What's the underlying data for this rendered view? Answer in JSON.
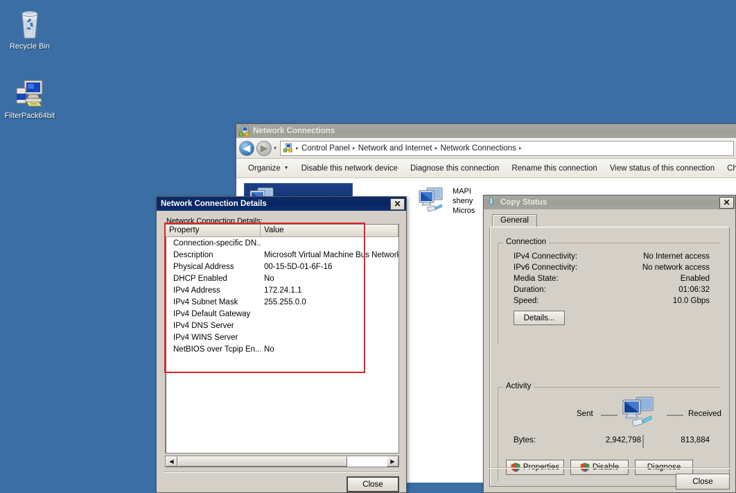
{
  "desktop": {
    "background_color": "#3a6ea5",
    "icons": [
      {
        "label": "Recycle Bin",
        "icon": "recycle-bin-icon"
      },
      {
        "label": "FilterPack64bit",
        "icon": "setup-installer-icon"
      }
    ]
  },
  "network_connections_window": {
    "title": "Network Connections",
    "icon": "network-connections-icon",
    "nav": {
      "back": "◀",
      "forward": "▶",
      "history_caret": "▾",
      "address_icon": "network-folder-icon",
      "breadcrumbs": [
        "Control Panel",
        "Network and Internet",
        "Network Connections"
      ],
      "separator": "▸"
    },
    "toolbar": [
      {
        "label": "Organize",
        "has_caret": true
      },
      {
        "label": "Disable this network device",
        "has_caret": false
      },
      {
        "label": "Diagnose this connection",
        "has_caret": false
      },
      {
        "label": "Rename this connection",
        "has_caret": false
      },
      {
        "label": "View status of this connection",
        "has_caret": false
      },
      {
        "label": "Change setti",
        "has_caret": false
      }
    ],
    "connections": [
      {
        "lines": [
          "MAPI",
          "sheny",
          "Micros"
        ],
        "icon": "network-adapter-icon",
        "selected": false
      }
    ]
  },
  "network_connection_details_dialog": {
    "title": "Network Connection Details",
    "close_glyph": "✕",
    "group_label": "Network Connection Details:",
    "columns": [
      "Property",
      "Value"
    ],
    "rows": [
      {
        "property": "Connection-specific DN...",
        "value": ""
      },
      {
        "property": "Description",
        "value": "Microsoft Virtual Machine Bus Network Ad"
      },
      {
        "property": "Physical Address",
        "value": "00-15-5D-01-6F-16"
      },
      {
        "property": "DHCP Enabled",
        "value": "No"
      },
      {
        "property": "IPv4 Address",
        "value": "172.24.1.1"
      },
      {
        "property": "IPv4 Subnet Mask",
        "value": "255.255.0.0"
      },
      {
        "property": "IPv4 Default Gateway",
        "value": ""
      },
      {
        "property": "IPv4 DNS Server",
        "value": ""
      },
      {
        "property": "IPv4 WINS Server",
        "value": ""
      },
      {
        "property": "NetBIOS over Tcpip En...",
        "value": "No"
      }
    ],
    "scroll_left_glyph": "◀",
    "scroll_right_glyph": "▶",
    "close_button": "Close"
  },
  "copy_status_dialog": {
    "title": "Copy Status",
    "icon": "status-icon",
    "close_glyph": "✕",
    "tab": "General",
    "connection": {
      "legend": "Connection",
      "rows": [
        {
          "label": "IPv4 Connectivity:",
          "value": "No Internet access"
        },
        {
          "label": "IPv6 Connectivity:",
          "value": "No network access"
        },
        {
          "label": "Media State:",
          "value": "Enabled"
        },
        {
          "label": "Duration:",
          "value": "01:06:32"
        },
        {
          "label": "Speed:",
          "value": "10.0 Gbps"
        }
      ],
      "details_button": "Details..."
    },
    "activity": {
      "legend": "Activity",
      "sent_label": "Sent",
      "received_label": "Received",
      "bytes_label": "Bytes:",
      "sent_bytes": "2,942,798",
      "received_bytes": "813,884",
      "icon": "computers-network-icon"
    },
    "buttons": [
      {
        "label": "Properties",
        "shield": true
      },
      {
        "label": "Disable",
        "shield": true
      },
      {
        "label": "Diagnose",
        "shield": false
      }
    ],
    "close_button": "Close"
  },
  "annotation": {
    "color": "#e02020",
    "shape": "rectangle-highlight"
  }
}
